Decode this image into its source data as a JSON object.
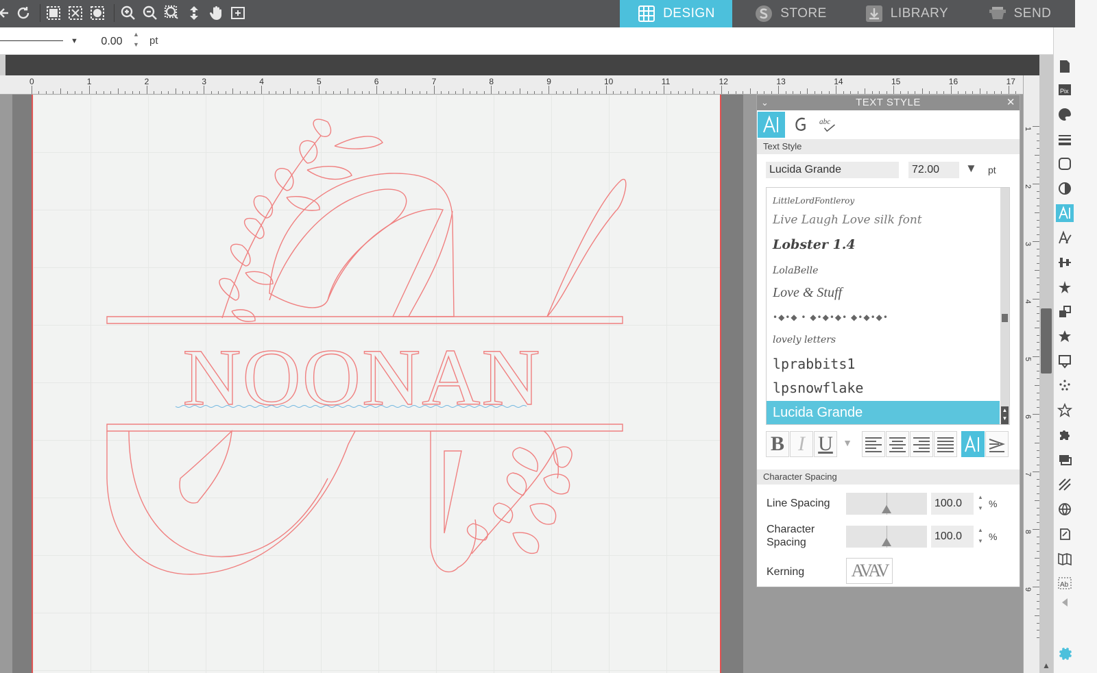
{
  "nav": {
    "tabs": [
      {
        "label": "DESIGN",
        "icon": "grid-icon",
        "active": true
      },
      {
        "label": "STORE",
        "icon": "s-logo-icon",
        "active": false
      },
      {
        "label": "LIBRARY",
        "icon": "download-box-icon",
        "active": false
      },
      {
        "label": "SEND",
        "icon": "cutter-icon",
        "active": false
      }
    ]
  },
  "line_options": {
    "width_value": "0.00",
    "unit": "pt"
  },
  "rulers": {
    "horizontal": [
      "0",
      "1",
      "2",
      "3",
      "4",
      "5",
      "6",
      "7",
      "8",
      "9",
      "10",
      "11",
      "12",
      "13",
      "14",
      "15",
      "16",
      "17"
    ],
    "vertical": [
      "1",
      "2",
      "3",
      "4",
      "5",
      "6",
      "7",
      "8",
      "9"
    ]
  },
  "design": {
    "surname": "NOONAN",
    "monogram_letter": "N",
    "stroke_color": "#f08080"
  },
  "panel": {
    "title": "TEXT STYLE",
    "tabs": [
      {
        "icon": "text-style-icon",
        "active": true
      },
      {
        "icon": "font-glyph-icon",
        "active": false
      },
      {
        "icon": "spellcheck-abc-icon",
        "active": false
      }
    ],
    "text_style_section": "Text Style",
    "font_name": "Lucida Grande",
    "font_size": "72.00",
    "size_unit": "pt",
    "fonts": [
      "LittleLordFontleroy",
      "Live Laugh Love silk font",
      "Lobster 1.4",
      "LolaBelle",
      "Love & Stuff",
      "•◆•◆ • ◆•◆•◆• ◆•◆•◆•",
      "lovely letters",
      "lprabbits1",
      "lpsnowflake",
      "Lucida Grande"
    ],
    "selected_font": "Lucida Grande",
    "format_buttons": {
      "bold": "B",
      "italic": "I",
      "underline": "U"
    },
    "character_spacing_section": "Character Spacing",
    "line_spacing_label": "Line Spacing",
    "line_spacing_value": "100.0",
    "char_spacing_label": "Character Spacing",
    "char_spacing_value": "100.0",
    "spacing_unit": "%",
    "kerning_label": "Kerning",
    "kerning_preview": "AVAV"
  },
  "colors": {
    "accent": "#4cc0dc",
    "topbar": "#555658",
    "cut_line": "#f08080"
  }
}
